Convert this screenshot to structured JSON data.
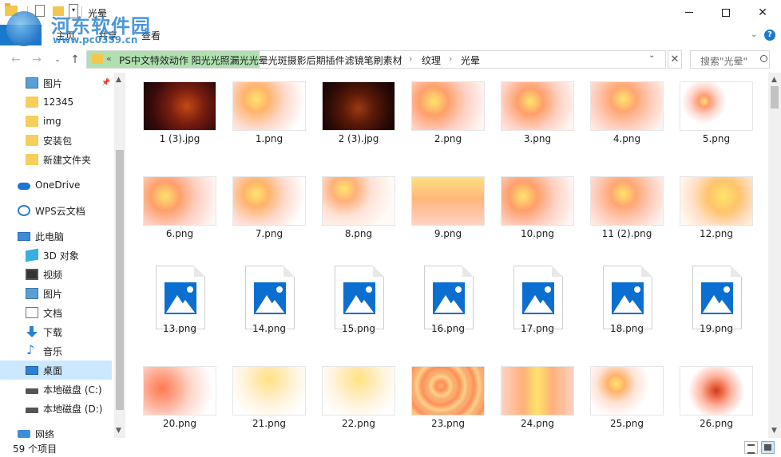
{
  "window": {
    "title": "光晕",
    "watermark": {
      "name": "河东软件园",
      "url": "www.pc0359.cn"
    }
  },
  "ribbon": {
    "tabs": [
      "主页",
      "共享",
      "查看"
    ]
  },
  "nav": {
    "address": {
      "overflow_chevron": "«",
      "crumbs": [
        "PS中文特效动作 阳光光照漏光光晕光斑摄影后期插件滤镜笔刷素材",
        "纹理",
        "光晕"
      ],
      "separator": "›"
    },
    "search_placeholder": "搜索\"光晕\""
  },
  "sidebar": {
    "items": [
      {
        "label": "图片",
        "icon": "pictures-icon",
        "pinned": true
      },
      {
        "label": "12345",
        "icon": "folder-icon"
      },
      {
        "label": "img",
        "icon": "folder-icon"
      },
      {
        "label": "安装包",
        "icon": "folder-icon"
      },
      {
        "label": "新建文件夹",
        "icon": "folder-icon"
      },
      {
        "label": "OneDrive",
        "icon": "onedrive-cloud-icon"
      },
      {
        "label": "WPS云文档",
        "icon": "wps-cloud-icon"
      },
      {
        "label": "此电脑",
        "icon": "this-pc-icon"
      },
      {
        "label": "3D 对象",
        "icon": "3d-objects-icon"
      },
      {
        "label": "视频",
        "icon": "video-icon"
      },
      {
        "label": "图片",
        "icon": "pictures-icon"
      },
      {
        "label": "文档",
        "icon": "documents-icon"
      },
      {
        "label": "下载",
        "icon": "download-icon"
      },
      {
        "label": "音乐",
        "icon": "music-icon"
      },
      {
        "label": "桌面",
        "icon": "desktop-icon",
        "selected": true
      },
      {
        "label": "本地磁盘 (C:)",
        "icon": "drive-icon"
      },
      {
        "label": "本地磁盘 (D:)",
        "icon": "drive-icon"
      },
      {
        "label": "网络",
        "icon": "network-icon"
      }
    ]
  },
  "files": [
    {
      "name": "1 (3).jpg",
      "thumb": "dark-red"
    },
    {
      "name": "1.png",
      "thumb": "glow-soft"
    },
    {
      "name": "2 (3).jpg",
      "thumb": "dark-brown"
    },
    {
      "name": "2.png",
      "thumb": "glow-left"
    },
    {
      "name": "3.png",
      "thumb": "glow-center"
    },
    {
      "name": "4.png",
      "thumb": "glow-wide"
    },
    {
      "name": "5.png",
      "thumb": "glow-small"
    },
    {
      "name": "6.png",
      "thumb": "glow-left"
    },
    {
      "name": "7.png",
      "thumb": "glow-soft"
    },
    {
      "name": "8.png",
      "thumb": "glow-topleft"
    },
    {
      "name": "9.png",
      "thumb": "glow-band"
    },
    {
      "name": "10.png",
      "thumb": "glow-left"
    },
    {
      "name": "11 (2).png",
      "thumb": "glow-wide"
    },
    {
      "name": "12.png",
      "thumb": "glow-yellow"
    },
    {
      "name": "13.png",
      "thumb": "file"
    },
    {
      "name": "14.png",
      "thumb": "file"
    },
    {
      "name": "15.png",
      "thumb": "file"
    },
    {
      "name": "16.png",
      "thumb": "file"
    },
    {
      "name": "17.png",
      "thumb": "file"
    },
    {
      "name": "18.png",
      "thumb": "file"
    },
    {
      "name": "19.png",
      "thumb": "file"
    },
    {
      "name": "20.png",
      "thumb": "glow-red"
    },
    {
      "name": "21.png",
      "thumb": "glow-faint"
    },
    {
      "name": "22.png",
      "thumb": "glow-faint"
    },
    {
      "name": "23.png",
      "thumb": "swirl"
    },
    {
      "name": "24.png",
      "thumb": "glow-streak"
    },
    {
      "name": "25.png",
      "thumb": "glow-burst"
    },
    {
      "name": "26.png",
      "thumb": "glow-ring"
    }
  ],
  "status": {
    "item_count": "59 个项目"
  },
  "colors": {
    "accent": "#1979ca",
    "selected": "#cce8ff",
    "address_highlight": "#8fd18f"
  }
}
